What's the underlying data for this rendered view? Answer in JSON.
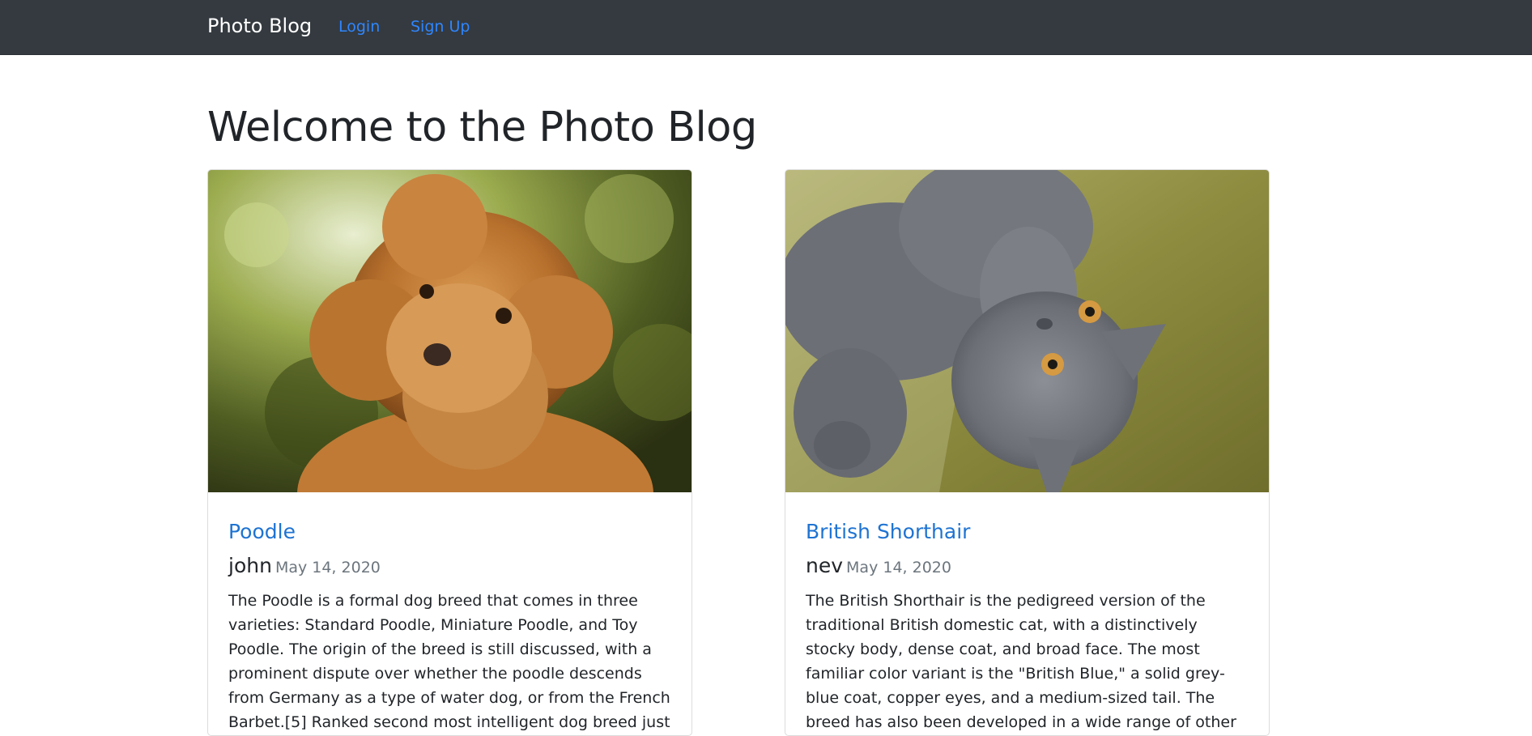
{
  "navbar": {
    "brand": "Photo Blog",
    "links": [
      {
        "label": "Login"
      },
      {
        "label": "Sign Up"
      }
    ]
  },
  "page": {
    "title": "Welcome to the Photo Blog"
  },
  "posts": [
    {
      "image_alt": "poodle-photo",
      "title": "Poodle",
      "author": "john",
      "date": "May 14, 2020",
      "text": "The Poodle is a formal dog breed that comes in three varieties: Standard Poodle, Miniature Poodle, and Toy Poodle. The origin of the breed is still discussed, with a prominent dispute over whether the poodle descends from Germany as a type of water dog, or from the French Barbet.[5] Ranked second most intelligent dog breed just behind the Border"
    },
    {
      "image_alt": "british-shorthair-photo",
      "title": "British Shorthair",
      "author": "nev",
      "date": "May 14, 2020",
      "text": "The British Shorthair is the pedigreed version of the traditional British domestic cat, with a distinctively stocky body, dense coat, and broad face. The most familiar color variant is the \"British Blue,\" a solid grey-blue coat, copper eyes, and a medium-sized tail. The breed has also been developed in a wide range of other colours and patterns"
    }
  ],
  "colors": {
    "navbar_bg": "#343a40",
    "link": "#2f86ff",
    "card_title": "#1e73d2",
    "muted": "#6c757d"
  }
}
